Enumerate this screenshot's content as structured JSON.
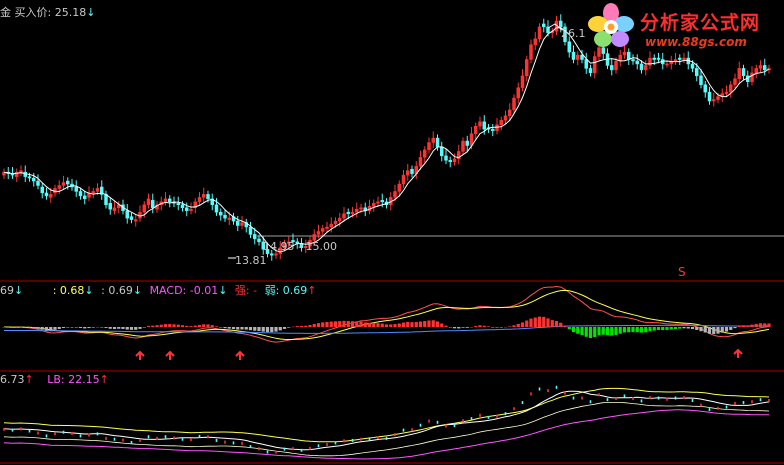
{
  "header": {
    "stock_glyph": "金",
    "buy_label": "买入价:",
    "buy_value": "25.18",
    "buy_arrow": "↓"
  },
  "logo": {
    "title": "分析家公式网",
    "url": "www.88gs.com",
    "flower_icon": "flower-logo-icon"
  },
  "annotations": {
    "high_label": "26.1",
    "low_label": "13.81",
    "range_label": "14.95 - 15.00",
    "s_marker": "S"
  },
  "macd_bar": {
    "v1": "69",
    "a1": "↓",
    "v2": ": 0.68",
    "a2": "↓",
    "v3": ": 0.69",
    "a3": "↓",
    "macd": "MACD: -0.01",
    "a4": "↓",
    "strong": "强: -",
    "weak": "弱: 0.69",
    "a5": "↑"
  },
  "lb_bar": {
    "v1": "6.73",
    "a1": "↑",
    "lb": "LB: 22.15",
    "a2": "↑"
  },
  "colors": {
    "up": "#ff3232",
    "down": "#54fcfc",
    "hist_pos": "#ff3232",
    "hist_neg_gray": "#b4b4b4",
    "hist_neg_green": "#00e600",
    "border": "#b00000",
    "text": "#c8c8c8",
    "yellow": "#ffff54",
    "magenta": "#ff54ff"
  },
  "chart_data": {
    "type": "candlestick",
    "closes": [
      19.6,
      19.5,
      19.4,
      19.6,
      19.7,
      19.3,
      19.2,
      19.0,
      18.7,
      18.2,
      18.0,
      18.1,
      18.5,
      18.7,
      18.9,
      18.8,
      18.6,
      18.3,
      18.0,
      17.8,
      18.2,
      18.3,
      18.5,
      18.1,
      17.4,
      17.1,
      17.2,
      17.4,
      17.0,
      16.5,
      16.4,
      16.4,
      16.9,
      17.4,
      17.8,
      17.2,
      17.4,
      17.6,
      17.8,
      17.6,
      17.5,
      17.4,
      17.2,
      17.0,
      17.1,
      17.6,
      17.9,
      18.1,
      17.8,
      17.4,
      16.9,
      16.7,
      16.5,
      16.5,
      16.3,
      16.0,
      16.2,
      15.9,
      15.4,
      15.1,
      14.9,
      14.4,
      14.1,
      14.0,
      14.1,
      14.5,
      14.8,
      14.9,
      14.9,
      14.8,
      14.5,
      14.6,
      15.0,
      15.4,
      15.6,
      15.8,
      15.9,
      16.1,
      16.3,
      16.5,
      16.8,
      16.8,
      16.9,
      17.1,
      17.2,
      17.0,
      17.3,
      17.5,
      17.6,
      17.6,
      17.4,
      17.9,
      18.3,
      18.8,
      19.4,
      19.7,
      19.5,
      20.0,
      20.6,
      21.1,
      21.6,
      21.9,
      21.3,
      20.7,
      20.4,
      20.3,
      20.5,
      21.0,
      21.7,
      21.4,
      22.2,
      22.7,
      23.0,
      22.5,
      22.5,
      22.4,
      22.8,
      23.1,
      23.4,
      23.8,
      24.6,
      25.3,
      26.1,
      27.2,
      28.2,
      28.6,
      29.4,
      29.4,
      29.0,
      29.1,
      29.8,
      29.4,
      28.4,
      27.7,
      27.2,
      27.5,
      27.2,
      26.6,
      26.3,
      27.4,
      28.0,
      27.6,
      26.8,
      26.5,
      27.1,
      27.5,
      27.7,
      27.2,
      27.1,
      26.9,
      26.5,
      26.8,
      27.3,
      27.2,
      27.2,
      26.9,
      26.9,
      27.1,
      27.2,
      27.2,
      27.3,
      26.9,
      26.6,
      26.1,
      25.5,
      25.0,
      24.4,
      24.5,
      24.7,
      24.9,
      25.0,
      25.5,
      25.9,
      26.6,
      26.1,
      25.7,
      26.3,
      26.6,
      26.8,
      26.5,
      26.6
    ],
    "opens": [
      19.4,
      19.6,
      19.5,
      19.3,
      19.6,
      19.6,
      19.3,
      19.2,
      19.0,
      18.6,
      18.2,
      17.9,
      18.2,
      18.5,
      18.7,
      19.0,
      18.8,
      18.6,
      18.3,
      18.0,
      17.9,
      18.2,
      18.3,
      18.6,
      18.1,
      17.5,
      17.0,
      17.2,
      17.4,
      17.0,
      16.6,
      16.3,
      16.5,
      16.9,
      17.4,
      17.7,
      17.1,
      17.4,
      17.6,
      17.8,
      17.6,
      17.5,
      17.4,
      17.2,
      17.0,
      17.2,
      17.6,
      17.9,
      18.1,
      17.8,
      17.4,
      16.9,
      16.7,
      16.4,
      16.6,
      16.3,
      16.0,
      16.2,
      15.9,
      15.4,
      15.1,
      14.9,
      14.4,
      14.1,
      14.0,
      14.1,
      14.5,
      14.8,
      15.0,
      14.9,
      14.8,
      14.5,
      14.6,
      15.0,
      15.4,
      15.6,
      15.8,
      15.9,
      16.1,
      16.3,
      16.5,
      16.9,
      16.8,
      16.9,
      17.1,
      17.2,
      17.0,
      17.3,
      17.5,
      17.7,
      17.6,
      17.4,
      17.9,
      18.3,
      18.8,
      19.4,
      19.8,
      19.5,
      20.0,
      20.6,
      21.1,
      21.6,
      21.9,
      21.3,
      20.7,
      20.4,
      20.3,
      20.5,
      21.0,
      21.7,
      21.4,
      22.2,
      22.7,
      23.0,
      22.6,
      22.5,
      22.4,
      22.8,
      23.1,
      23.4,
      23.8,
      24.6,
      25.3,
      26.1,
      27.2,
      28.2,
      28.6,
      29.6,
      29.4,
      29.0,
      29.1,
      29.8,
      29.4,
      28.4,
      27.7,
      27.2,
      27.5,
      27.2,
      26.6,
      26.3,
      27.4,
      28.0,
      27.6,
      26.8,
      26.5,
      27.1,
      27.5,
      27.7,
      27.2,
      27.1,
      26.9,
      26.5,
      26.8,
      27.3,
      27.3,
      27.2,
      26.9,
      26.9,
      27.1,
      27.3,
      27.2,
      27.3,
      26.9,
      26.6,
      26.1,
      25.5,
      25.0,
      24.4,
      24.5,
      24.7,
      24.9,
      25.0,
      25.5,
      25.9,
      26.6,
      26.1,
      25.7,
      26.3,
      26.6,
      26.8,
      26.5
    ],
    "y_range": [
      13.0,
      30.0
    ],
    "macd_range": [
      -0.9,
      0.9
    ],
    "lb_range": [
      0.0,
      1.0
    ]
  }
}
